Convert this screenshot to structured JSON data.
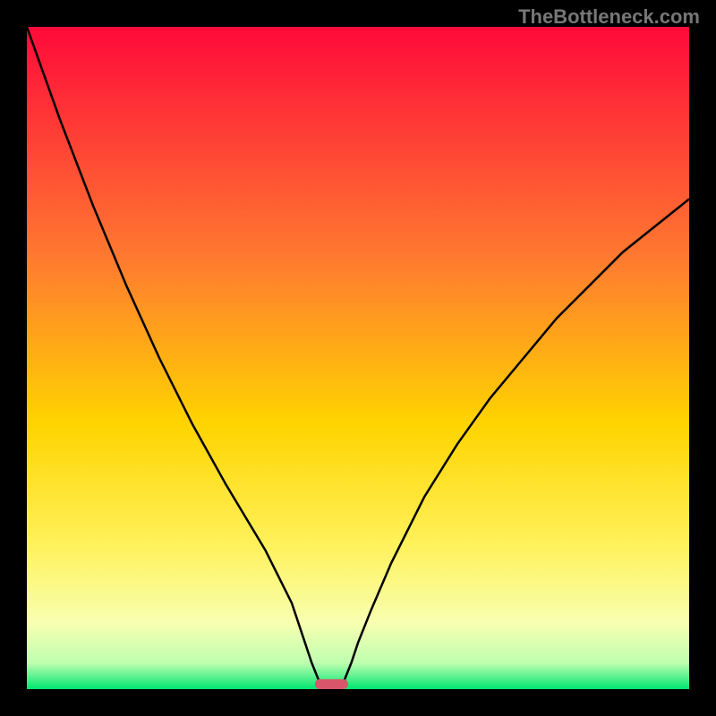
{
  "watermark": "TheBottleneck.com",
  "chart_data": {
    "type": "line",
    "title": "",
    "xlabel": "",
    "ylabel": "",
    "xlim": [
      0,
      100
    ],
    "ylim": [
      0,
      100
    ],
    "background_gradient": {
      "stops": [
        {
          "pct": 0,
          "color": "#ff0a3a"
        },
        {
          "pct": 35,
          "color": "#ff7a30"
        },
        {
          "pct": 60,
          "color": "#ffd400"
        },
        {
          "pct": 78,
          "color": "#fff15a"
        },
        {
          "pct": 90,
          "color": "#f8ffb0"
        },
        {
          "pct": 96,
          "color": "#c0ffb0"
        },
        {
          "pct": 100,
          "color": "#00e670"
        }
      ]
    },
    "series": [
      {
        "name": "left-curve",
        "color": "#000000",
        "width": 2.5,
        "x": [
          0,
          5,
          10,
          15,
          20,
          25,
          30,
          33,
          36,
          38,
          40,
          41,
          42,
          43,
          44,
          44.5
        ],
        "y": [
          100,
          86,
          73,
          61,
          50,
          40,
          31,
          26,
          21,
          17,
          13,
          10,
          7,
          4,
          1.5,
          0.5
        ]
      },
      {
        "name": "right-curve",
        "color": "#000000",
        "width": 2.5,
        "x": [
          47.5,
          48,
          49,
          50,
          52,
          55,
          60,
          65,
          70,
          75,
          80,
          85,
          90,
          95,
          100
        ],
        "y": [
          0.5,
          1.5,
          4,
          7,
          12,
          19,
          29,
          37,
          44,
          50,
          56,
          61,
          66,
          70,
          74
        ]
      }
    ],
    "marker": {
      "name": "bottleneck-marker",
      "color": "#d9566a",
      "x": 46,
      "y": 0,
      "width": 5,
      "height": 1.5
    }
  }
}
